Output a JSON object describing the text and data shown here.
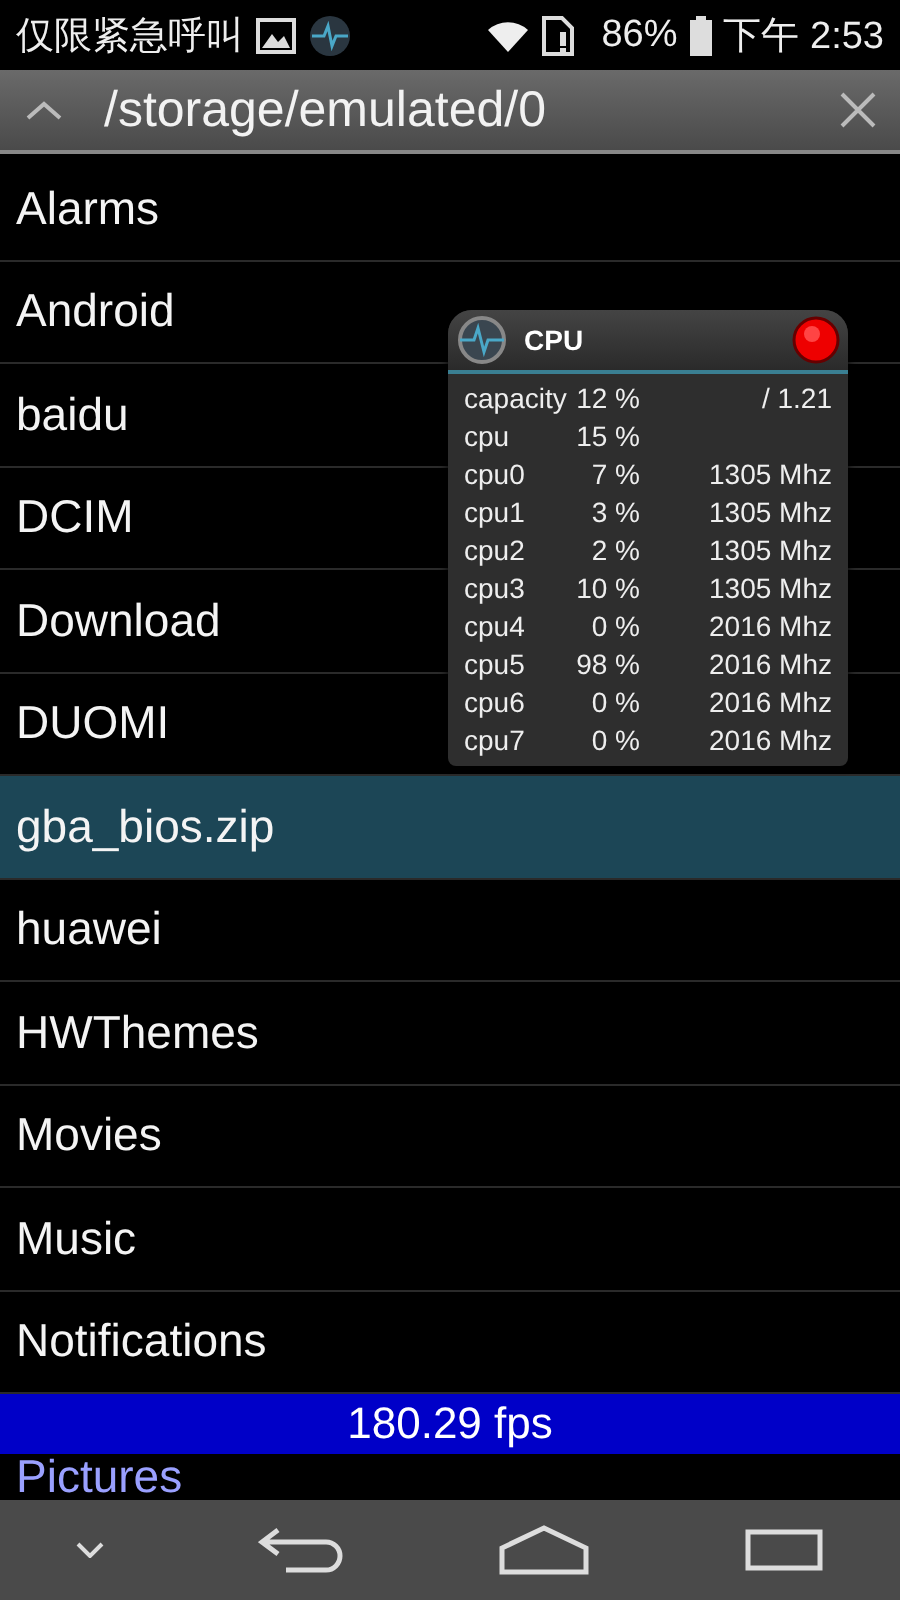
{
  "status_bar": {
    "carrier": "仅限紧急呼叫",
    "battery": "86%",
    "time": "下午 2:53"
  },
  "toolbar": {
    "path": "/storage/emulated/0"
  },
  "files": [
    {
      "name": "Alarms",
      "selected": false
    },
    {
      "name": "Android",
      "selected": false
    },
    {
      "name": "baidu",
      "selected": false
    },
    {
      "name": "DCIM",
      "selected": false
    },
    {
      "name": "Download",
      "selected": false
    },
    {
      "name": "DUOMI",
      "selected": false
    },
    {
      "name": "gba_bios.zip",
      "selected": true
    },
    {
      "name": "huawei",
      "selected": false
    },
    {
      "name": "HWThemes",
      "selected": false
    },
    {
      "name": "Movies",
      "selected": false
    },
    {
      "name": "Music",
      "selected": false
    },
    {
      "name": "Notifications",
      "selected": false
    },
    {
      "name": "Pictures",
      "selected": false
    }
  ],
  "cpu_widget": {
    "title": "CPU",
    "rows": [
      {
        "label": "capacity",
        "usage": "12 %",
        "extra": "/ 1.21"
      },
      {
        "label": "cpu",
        "usage": "15 %"
      },
      {
        "label": "cpu0",
        "usage": "7 %",
        "extra": "1305 Mhz"
      },
      {
        "label": "cpu1",
        "usage": "3 %",
        "extra": "1305 Mhz"
      },
      {
        "label": "cpu2",
        "usage": "2 %",
        "extra": "1305 Mhz"
      },
      {
        "label": "cpu3",
        "usage": "10 %",
        "extra": "1305 Mhz"
      },
      {
        "label": "cpu4",
        "usage": "0 %",
        "extra": "2016 Mhz"
      },
      {
        "label": "cpu5",
        "usage": "98 %",
        "extra": "2016 Mhz"
      },
      {
        "label": "cpu6",
        "usage": "0 %",
        "extra": "2016 Mhz"
      },
      {
        "label": "cpu7",
        "usage": "0 %",
        "extra": "2016 Mhz"
      }
    ]
  },
  "fps": {
    "text": "180.29 fps"
  }
}
